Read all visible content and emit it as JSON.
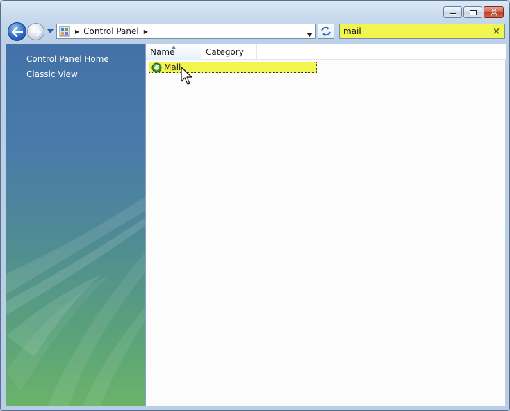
{
  "window": {
    "caption_buttons": [
      "minimize",
      "maximize",
      "close"
    ]
  },
  "nav": {
    "back_icon": "back-arrow-icon",
    "forward_icon": "forward-arrow-icon",
    "address": {
      "icon": "control-panel-icon",
      "breadcrumb": [
        "Control Panel"
      ]
    },
    "refresh_icon": "refresh-icon"
  },
  "search": {
    "value": "mail",
    "highlight_color": "#f3f54f"
  },
  "tasks": {
    "items": [
      {
        "label": "Control Panel Home"
      },
      {
        "label": "Classic View"
      }
    ]
  },
  "list": {
    "columns": [
      {
        "label": "Name",
        "sorted": "ascending"
      },
      {
        "label": "Category"
      }
    ],
    "items": [
      {
        "label": "Mail",
        "icon": "mail-icon",
        "selected": true
      }
    ]
  }
}
